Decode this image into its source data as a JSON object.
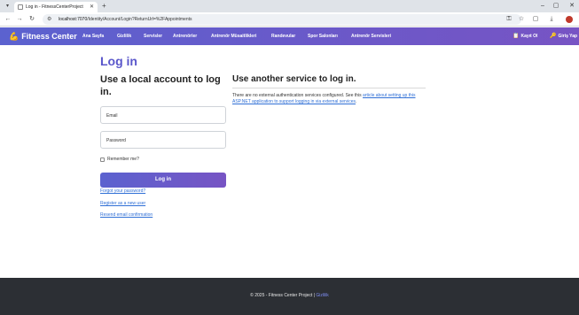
{
  "browser": {
    "tab_title": "Log in - FitnessCenterProject",
    "tab_close": "✕",
    "new_tab": "+",
    "url_host": "localhost:7070",
    "url_path": "/Identity/Account/Login?ReturnUrl=%2FAppointments",
    "win_minimize": "–",
    "win_restore": "▢",
    "win_close": "✕"
  },
  "navbar": {
    "brand": "Fitness Center",
    "links": [
      "Ana Sayfa",
      "Gizlilik",
      "Servisler",
      "Antrenörler",
      "Antrenör Müsaitlikleri",
      "Randevular",
      "Spor Salonları",
      "Antrenör Servisleri"
    ],
    "register": "Kayıt Ol",
    "login": "Giriş Yap"
  },
  "main": {
    "title": "Log in",
    "left_heading": "Use a local account to log in.",
    "email_label": "Email",
    "password_label": "Password",
    "remember_label": "Remember me?",
    "login_button": "Log in",
    "forgot_link": "Forgot your password?",
    "register_link": "Register as a new user",
    "resend_link": "Resend email confirmation",
    "right_heading": "Use another service to log in.",
    "external_text": "There are no external authentication services configured. See this ",
    "external_link": "article about setting up this ASP.NET application to support logging in via external services",
    "external_end": "."
  },
  "footer": {
    "text": "© 2025 - Fitness Center Project | ",
    "link": "Gizlilik"
  },
  "colors": {
    "brand_gradient_start": "#5b62cf",
    "brand_gradient_end": "#7754c4",
    "title": "#5a57cb",
    "link": "#2f6fd6",
    "footer_bg": "#2c2f34"
  }
}
